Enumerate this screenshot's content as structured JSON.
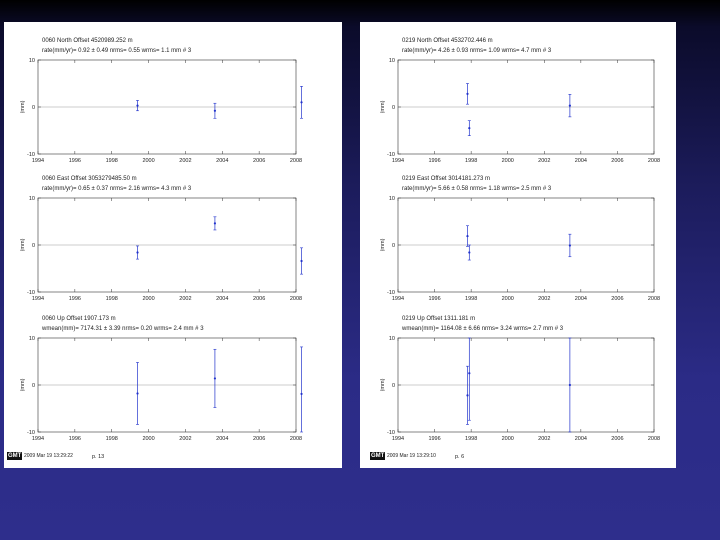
{
  "colors": {
    "series": "#2233cc",
    "axis": "#333333",
    "zero_line": "#999999"
  },
  "x_ticks": [
    "1994",
    "1996",
    "1998",
    "2000",
    "2002",
    "2004",
    "2006",
    "2008"
  ],
  "panels": [
    {
      "site": "0060",
      "footer": {
        "logo": "GMT",
        "timestamp": "2009 Mar 19 13:29:22",
        "page": "p. 13"
      },
      "chart_data": [
        {
          "type": "scatter",
          "title": "0060  North Offset    4520989.252 m",
          "subtitle": "rate(mm/yr)=    0.92 ±  0.49   nrms=   0.55   wrms=     1.1  mm # 3",
          "ylabel": "(mm)",
          "xlim": [
            1994,
            2008
          ],
          "ylim": [
            -10,
            10
          ],
          "yticks": [
            "10",
            "0",
            "-10"
          ],
          "points": [
            {
              "x": 1999.4,
              "y": 0.3,
              "err": 1.1
            },
            {
              "x": 2003.6,
              "y": -0.8,
              "err": 1.6
            },
            {
              "x": 2008.3,
              "y": 1.0,
              "err": 3.4
            }
          ]
        },
        {
          "type": "scatter",
          "title": "0060  East Offset    3053279485.50 m",
          "subtitle": "rate(mm/yr)=    0.65 ±  0.37   nrms=   2.16   wrms=     4.3  mm # 3",
          "ylabel": "(mm)",
          "xlim": [
            1994,
            2008
          ],
          "ylim": [
            -10,
            10
          ],
          "yticks": [
            "10",
            "0",
            "-10"
          ],
          "points": [
            {
              "x": 1999.4,
              "y": -1.6,
              "err": 1.4
            },
            {
              "x": 2003.6,
              "y": 4.6,
              "err": 1.4
            },
            {
              "x": 2008.3,
              "y": -3.4,
              "err": 2.8
            }
          ]
        },
        {
          "type": "scatter",
          "title": "0060  Up Offset        1907.173 m",
          "subtitle": "wmean(mm)=  7174.31 ±  3.39   nrms=   0.20   wrms=     2.4  mm # 3",
          "ylabel": "(mm)",
          "xlim": [
            1994,
            2008
          ],
          "ylim": [
            -10,
            10
          ],
          "yticks": [
            "10",
            "0",
            "-10"
          ],
          "points": [
            {
              "x": 1999.4,
              "y": -1.8,
              "err": 6.6
            },
            {
              "x": 2003.6,
              "y": 1.4,
              "err": 6.2
            },
            {
              "x": 2008.3,
              "y": -1.9,
              "err": 10
            }
          ]
        }
      ]
    },
    {
      "site": "0219",
      "footer": {
        "logo": "GMT",
        "timestamp": "2009 Mar 19 13:29:10",
        "page": "p. 6"
      },
      "chart_data": [
        {
          "type": "scatter",
          "title": "0219  North Offset    4532702.446 m",
          "subtitle": "rate(mm/yr)=    4.26 ±  0.93   nrms=   1.09   wrms=     4.7  mm # 3",
          "ylabel": "(mm)",
          "xlim": [
            1994,
            2008
          ],
          "ylim": [
            -10,
            10
          ],
          "yticks": [
            "10",
            "0",
            "-10"
          ],
          "points": [
            {
              "x": 1997.8,
              "y": 2.8,
              "err": 2.2
            },
            {
              "x": 1997.9,
              "y": -4.5,
              "err": 1.6
            },
            {
              "x": 2003.4,
              "y": 0.3,
              "err": 2.4
            }
          ]
        },
        {
          "type": "scatter",
          "title": "0219  East Offset    3014181.273 m",
          "subtitle": "rate(mm/yr)=    5.66 ±  0.58   nrms=   1.18   wrms=     2.5  mm # 3",
          "ylabel": "(mm)",
          "xlim": [
            1994,
            2008
          ],
          "ylim": [
            -10,
            10
          ],
          "yticks": [
            "10",
            "0",
            "-10"
          ],
          "points": [
            {
              "x": 1997.8,
              "y": 1.9,
              "err": 2.2
            },
            {
              "x": 1997.9,
              "y": -1.6,
              "err": 1.6
            },
            {
              "x": 2003.4,
              "y": -0.1,
              "err": 2.4
            }
          ]
        },
        {
          "type": "scatter",
          "title": "0219  Up Offset        1311.181 m",
          "subtitle": "wmean(mm)=  1164.08 ±  6.66   nrms=   3.24   wrms=     2.7  mm # 3",
          "ylabel": "(mm)",
          "xlim": [
            1994,
            2008
          ],
          "ylim": [
            -10,
            10
          ],
          "yticks": [
            "10",
            "0",
            "-10"
          ],
          "points": [
            {
              "x": 1997.8,
              "y": -2.2,
              "err": 6.2
            },
            {
              "x": 1997.9,
              "y": 2.5,
              "err": 10
            },
            {
              "x": 2003.4,
              "y": 0.0,
              "err": 10
            }
          ]
        }
      ]
    }
  ]
}
